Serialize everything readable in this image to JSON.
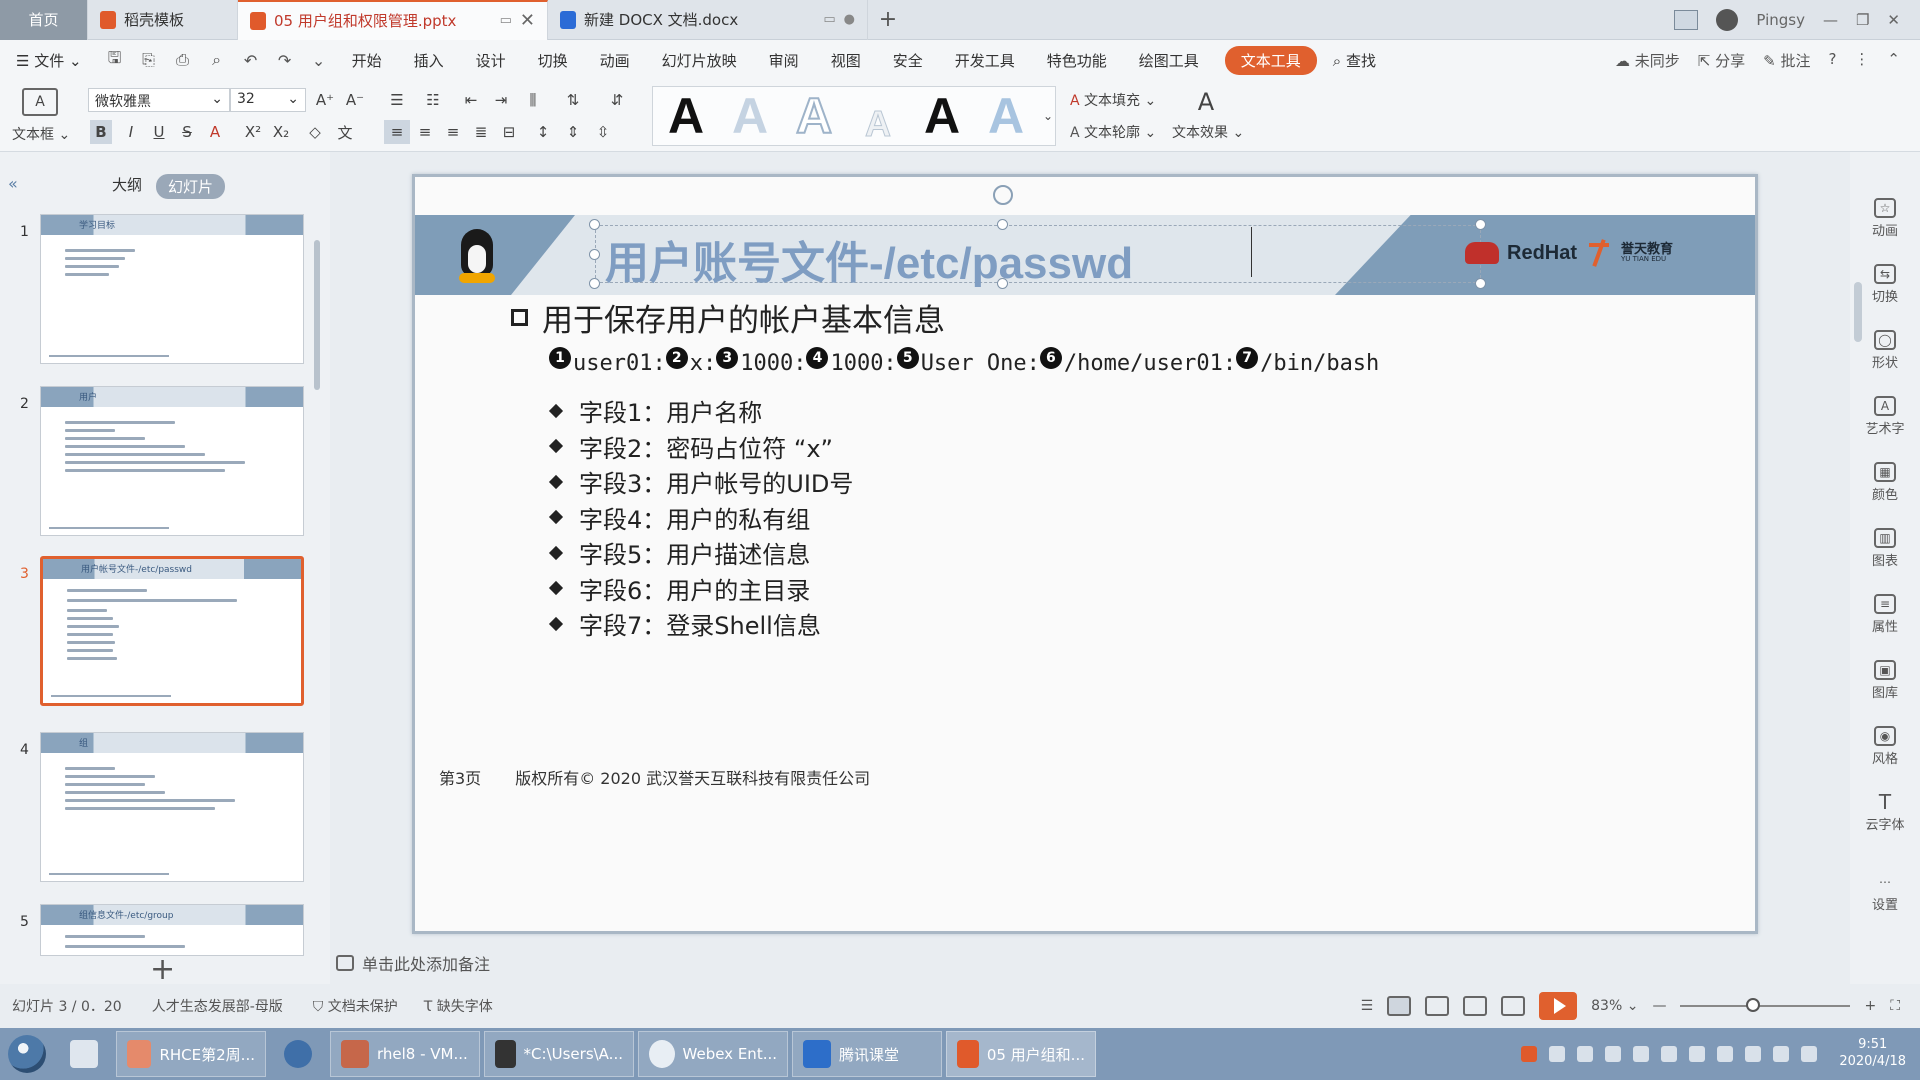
{
  "tabs": {
    "home": "首页",
    "daoke": "稻壳模板",
    "active": "05 用户组和权限管理.pptx",
    "docx": "新建 DOCX 文档.docx",
    "user": "Pingsy"
  },
  "menu": {
    "file": "文件",
    "items": [
      "开始",
      "插入",
      "设计",
      "切换",
      "动画",
      "幻灯片放映",
      "审阅",
      "视图",
      "安全",
      "开发工具",
      "特色功能",
      "绘图工具"
    ],
    "highlight": "文本工具",
    "search": "查找",
    "sync": "未同步",
    "share": "分享",
    "comment": "批注"
  },
  "ribbon": {
    "textbox": "文本框",
    "font": "微软雅黑",
    "size": "32",
    "text_fill": "文本填充",
    "text_outline": "文本轮廓",
    "text_effect": "文本效果",
    "big_a": "A"
  },
  "left_panel": {
    "outline_tab": "大纲",
    "slides_tab": "幻灯片",
    "thumbs": [
      {
        "num": "1",
        "title": "学习目标"
      },
      {
        "num": "2",
        "title": "用户"
      },
      {
        "num": "3",
        "title": "用户帐号文件-/etc/passwd"
      },
      {
        "num": "4",
        "title": "组"
      },
      {
        "num": "5",
        "title": "组信息文件-/etc/group"
      }
    ]
  },
  "slide": {
    "title": "用户账号文件-/etc/passwd",
    "brand": "RedHat",
    "brand2_cn": "誉天教育",
    "brand2_en": "YU TIAN EDU",
    "heading": "用于保存用户的帐户基本信息",
    "fields": [
      {
        "n": "1",
        "v": "user01:"
      },
      {
        "n": "2",
        "v": "x:"
      },
      {
        "n": "3",
        "v": "1000:"
      },
      {
        "n": "4",
        "v": "1000:"
      },
      {
        "n": "5",
        "v": "User One:"
      },
      {
        "n": "6",
        "v": "/home/user01:"
      },
      {
        "n": "7",
        "v": "/bin/bash"
      }
    ],
    "bullets": [
      "字段1：用户名称",
      "字段2：密码占位符 “x”",
      "字段3：用户帐号的UID号",
      "字段4：用户的私有组",
      "字段5：用户描述信息",
      "字段6：用户的主目录",
      "字段7：登录Shell信息"
    ],
    "page": "第3页",
    "copyright": "版权所有© 2020 武汉誉天互联科技有限责任公司"
  },
  "notes": "单击此处添加备注",
  "right_rail": [
    "动画",
    "切换",
    "形状",
    "艺术字",
    "颜色",
    "图表",
    "属性",
    "图库",
    "风格",
    "云字体",
    "设置"
  ],
  "status": {
    "slide_count": "幻灯片 3 / 0．20",
    "template": "人才生态发展部-母版",
    "protect": "文档未保护",
    "missing_font": "缺失字体",
    "zoom": "83%",
    "zoom_level_percent": 83
  },
  "taskbar": {
    "apps": [
      "RHCE第2周...",
      "rhel8 - VM...",
      "*C:\\Users\\A...",
      "Webex Ent...",
      "腾讯课堂",
      "05 用户组和..."
    ],
    "time": "9:51",
    "date": "2020/4/18"
  },
  "colors": {
    "accent": "#e0602e",
    "slide_blue": "#7f9db8",
    "title_blue": "#7f9dc2"
  }
}
